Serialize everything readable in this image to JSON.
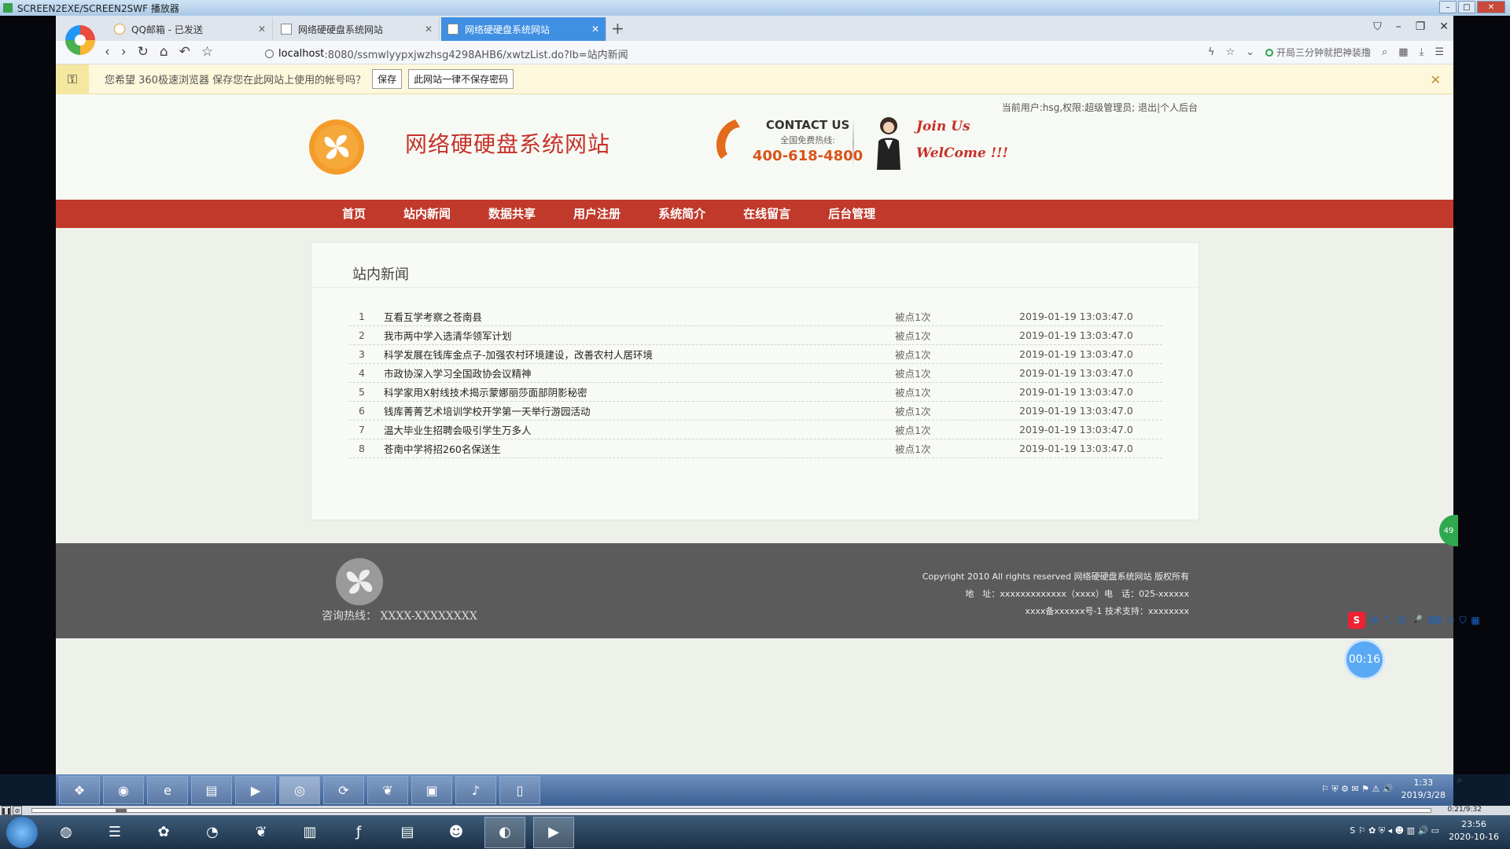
{
  "player": {
    "title": "SCREEN2EXE/SCREEN2SWF 播放器",
    "time": "0:21/9:32"
  },
  "browser": {
    "tabs": [
      {
        "label": "QQ邮箱 - 已发送"
      },
      {
        "label": "网络硬硬盘系统网站"
      },
      {
        "label": "网络硬硬盘系统网站"
      }
    ],
    "url_host": "localhost",
    "url_path": ":8080/ssmwlyypxjwzhsg4298AHB6/xwtzList.do?lb=站内新闻",
    "promo": "开局三分钟就把神装撸",
    "password_bar": {
      "message": "您希望 360极速浏览器 保存您在此网站上使用的帐号吗？",
      "save": "保存",
      "never": "此网站一律不保存密码"
    }
  },
  "site": {
    "user_info": "当前用户:hsg,权限:超级管理员; 退出|个人后台",
    "title": "网络硬硬盘系统网站",
    "contact_title": "CONTACT US",
    "contact_sub": "全国免费热线:",
    "contact_number": "400-618-4800",
    "join_line1": "Join Us",
    "join_line2": "WelCome !!!",
    "nav": [
      "首页",
      "站内新闻",
      "数据共享",
      "用户注册",
      "系统简介",
      "在线留言",
      "后台管理"
    ],
    "section_title": "站内新闻",
    "news": [
      {
        "num": "1",
        "title": "互看互学考察之苍南县",
        "clicks": "被点1次",
        "date": "2019-01-19 13:03:47.0"
      },
      {
        "num": "2",
        "title": "我市两中学入选清华领军计划",
        "clicks": "被点1次",
        "date": "2019-01-19 13:03:47.0"
      },
      {
        "num": "3",
        "title": "科学发展在钱库金点子-加强农村环境建设，改善农村人居环境",
        "clicks": "被点1次",
        "date": "2019-01-19 13:03:47.0"
      },
      {
        "num": "4",
        "title": "市政协深入学习全国政协会议精神",
        "clicks": "被点1次",
        "date": "2019-01-19 13:03:47.0"
      },
      {
        "num": "5",
        "title": "科学家用X射线技术揭示蒙娜丽莎面部阴影秘密",
        "clicks": "被点1次",
        "date": "2019-01-19 13:03:47.0"
      },
      {
        "num": "6",
        "title": "钱库菁菁艺术培训学校开学第一天举行游园活动",
        "clicks": "被点1次",
        "date": "2019-01-19 13:03:47.0"
      },
      {
        "num": "7",
        "title": "温大毕业生招聘会吸引学生万多人",
        "clicks": "被点1次",
        "date": "2019-01-19 13:03:47.0"
      },
      {
        "num": "8",
        "title": "苍南中学将招260名保送生",
        "clicks": "被点1次",
        "date": "2019-01-19 13:03:47.0"
      }
    ],
    "footer_hotline": "咨询热线： XXXX-XXXXXXXX",
    "footer_copyright": "Copyright 2010 All rights reserved 网络硬硬盘系统网站 版权所有",
    "footer_address": "地　址：xxxxxxxxxxxxx（xxxx）电　话：025-xxxxxx",
    "footer_icp": "xxxx备xxxxxx号-1 技术支持：xxxxxxxx"
  },
  "floating": {
    "timer": "00:16",
    "badge": "49"
  },
  "inner_clock": {
    "time": "1:33",
    "date": "2019/3/28"
  },
  "outer_clock": {
    "time": "23:56",
    "date": "2020-10-16"
  },
  "colors": {
    "nav_red": "#c0392b",
    "title_red": "#c6312a",
    "tab_active": "#3f8fe3",
    "footer": "#5b5b5b"
  }
}
